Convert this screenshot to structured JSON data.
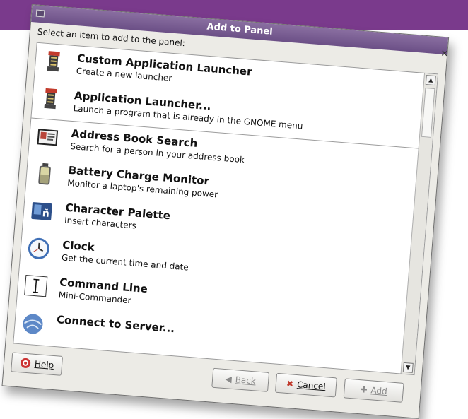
{
  "dialog": {
    "title": "Add to Panel",
    "instruction": "Select an item to add to the panel:"
  },
  "items": [
    {
      "title": "Custom Application Launcher",
      "desc": "Create a new launcher",
      "icon": "launcher-icon"
    },
    {
      "title": "Application Launcher...",
      "desc": "Launch a program that is already in the GNOME menu",
      "icon": "launcher-icon"
    },
    {
      "title": "Address Book Search",
      "desc": "Search for a person in your address book",
      "icon": "address-book-icon"
    },
    {
      "title": "Battery Charge Monitor",
      "desc": "Monitor a laptop's remaining power",
      "icon": "battery-icon"
    },
    {
      "title": "Character Palette",
      "desc": "Insert characters",
      "icon": "character-palette-icon"
    },
    {
      "title": "Clock",
      "desc": "Get the current time and date",
      "icon": "clock-icon"
    },
    {
      "title": "Command Line",
      "desc": "Mini-Commander",
      "icon": "command-line-icon"
    },
    {
      "title": "Connect to Server...",
      "desc": "",
      "icon": "network-icon"
    }
  ],
  "buttons": {
    "help": "Help",
    "back": "Back",
    "cancel": "Cancel",
    "add": "Add"
  },
  "colors": {
    "accent": "#7a3a8c",
    "titlebar": "#6b4f86"
  }
}
